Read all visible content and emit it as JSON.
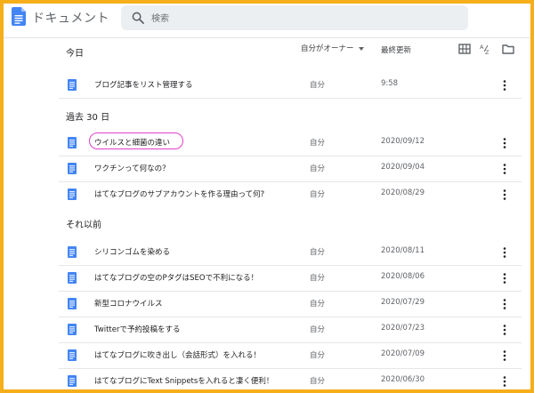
{
  "app": {
    "title": "ドキュメント",
    "logo_icon": "google-docs-logo",
    "accent_color": "#4285f4"
  },
  "search": {
    "placeholder": "検索",
    "value": ""
  },
  "list_header": {
    "owner_filter_label": "自分がオーナー",
    "last_modified_label": "最終更新",
    "tools": [
      "grid-view-icon",
      "sort-az-icon",
      "folder-icon"
    ]
  },
  "sections": [
    {
      "title": "今日",
      "docs": [
        {
          "title": "ブログ記事をリスト管理する",
          "owner": "自分",
          "date": "9:58"
        }
      ]
    },
    {
      "title": "過去 30 日",
      "docs": [
        {
          "title": "ウイルスと細菌の違い",
          "owner": "自分",
          "date": "2020/09/12",
          "highlighted": true
        },
        {
          "title": "ワクチンって何なの？",
          "owner": "自分",
          "date": "2020/09/04"
        },
        {
          "title": "はてなブログのサブアカウントを作る理由って何?",
          "owner": "自分",
          "date": "2020/08/29"
        }
      ]
    },
    {
      "title": "それ以前",
      "docs": [
        {
          "title": "シリコンゴムを染める",
          "owner": "自分",
          "date": "2020/08/11"
        },
        {
          "title": "はてなブログの空のPタグはSEOで不利になる！",
          "owner": "自分",
          "date": "2020/08/06"
        },
        {
          "title": "新型コロナウイルス",
          "owner": "自分",
          "date": "2020/07/29"
        },
        {
          "title": "Twitterで予約投稿をする",
          "owner": "自分",
          "date": "2020/07/23"
        },
        {
          "title": "はてなブログに吹き出し（会話形式）を入れる！",
          "owner": "自分",
          "date": "2020/07/09"
        },
        {
          "title": "はてなブログにText Snippetsを入れると凄く便利！",
          "owner": "自分",
          "date": "2020/06/30"
        }
      ]
    }
  ],
  "colors": {
    "frame_border": "#f6ae1b",
    "highlight_ring": "#e040c8",
    "doc_icon": "#4285f4"
  }
}
